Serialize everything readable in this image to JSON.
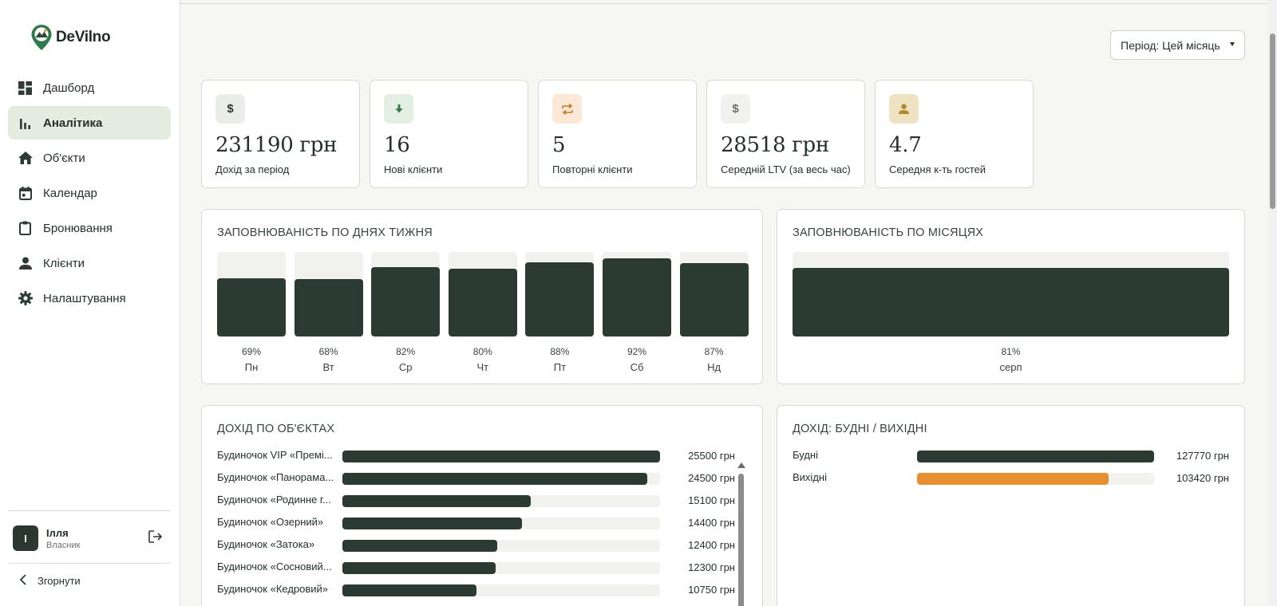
{
  "brand": {
    "name": "DeVilno"
  },
  "sidebar": {
    "items": [
      {
        "label": "Дашборд",
        "icon": "dashboard-icon",
        "active": false
      },
      {
        "label": "Аналітика",
        "icon": "bar-chart-icon",
        "active": true
      },
      {
        "label": "Об'єкти",
        "icon": "home-icon",
        "active": false
      },
      {
        "label": "Календар",
        "icon": "calendar-icon",
        "active": false
      },
      {
        "label": "Бронювання",
        "icon": "clipboard-icon",
        "active": false
      },
      {
        "label": "Клієнти",
        "icon": "person-icon",
        "active": false
      },
      {
        "label": "Налаштування",
        "icon": "gear-icon",
        "active": false
      }
    ],
    "user": {
      "initial": "І",
      "name": "Ілля",
      "role": "Власник"
    },
    "collapse_label": "Згорнути"
  },
  "period": {
    "label": "Період: Цей місяць"
  },
  "kpis": [
    {
      "value": "231190 грн",
      "label": "Дохід за період",
      "icon": "dollar-icon",
      "glyph": "$",
      "bg": "#ebedeb",
      "fg": "#2b3a32"
    },
    {
      "value": "16",
      "label": "Нові клієнти",
      "icon": "arrow-down-icon",
      "glyph": "🡇",
      "bg": "#e3efe3",
      "fg": "#2f7a45"
    },
    {
      "value": "5",
      "label": "Повторні клієнти",
      "icon": "repeat-icon",
      "glyph": "⇄",
      "bg": "#fbe8d6",
      "fg": "#d0781f"
    },
    {
      "value": "28518 грн",
      "label": "Середній LTV (за весь час)",
      "icon": "dollar-icon",
      "glyph": "$",
      "bg": "#f1f1ef",
      "fg": "#6a6f6b"
    },
    {
      "value": "4.7",
      "label": "Середня к-ть гостей",
      "icon": "guest-icon",
      "glyph": "👤",
      "bg": "#efe2c2",
      "fg": "#b08a2e"
    }
  ],
  "occupancy_days": {
    "title": "ЗАПОВНЮВАНІСТЬ ПО ДНЯХ ТИЖНЯ",
    "chart_data": {
      "type": "bar",
      "categories": [
        "Пн",
        "Вт",
        "Ср",
        "Чт",
        "Пт",
        "Сб",
        "Нд"
      ],
      "values": [
        69,
        68,
        82,
        80,
        88,
        92,
        87
      ],
      "labels": [
        "69%",
        "68%",
        "82%",
        "80%",
        "88%",
        "92%",
        "87%"
      ],
      "ylim": [
        0,
        100
      ]
    }
  },
  "occupancy_months": {
    "title": "ЗАПОВНЮВАНІСТЬ ПО МІСЯЦЯХ",
    "chart_data": {
      "type": "bar",
      "categories": [
        "серп"
      ],
      "values": [
        81
      ],
      "labels": [
        "81%"
      ],
      "ylim": [
        0,
        100
      ]
    }
  },
  "revenue_objects": {
    "title": "ДОХІД ПО ОБ'ЄКТАХ",
    "chart_data": {
      "type": "bar",
      "orientation": "horizontal",
      "categories": [
        "Будиночок VIP «Преміум»",
        "Будиночок «Панорамний»",
        "Будиночок «Родинне гніздо»",
        "Будиночок «Озерний»",
        "Будиночок «Затока»",
        "Будиночок «Сосновий бір»",
        "Будиночок «Кедровий»"
      ],
      "display_names": [
        "Будиночок VIP «Премі...",
        "Будиночок «Панорама...",
        "Будиночок «Родинне г...",
        "Будиночок «Озерний»",
        "Будиночок «Затока»",
        "Будиночок «Сосновий...",
        "Будиночок «Кедровий»"
      ],
      "values": [
        25500,
        24500,
        15100,
        14400,
        12400,
        12300,
        10750
      ],
      "labels": [
        "25500 грн",
        "24500 грн",
        "15100 грн",
        "14400 грн",
        "12400 грн",
        "12300 грн",
        "10750 грн"
      ],
      "xlim": [
        0,
        25500
      ]
    }
  },
  "revenue_weekday": {
    "title": "ДОХІД: БУДНІ / ВИХІДНІ",
    "chart_data": {
      "type": "bar",
      "orientation": "horizontal",
      "categories": [
        "Будні",
        "Вихідні"
      ],
      "values": [
        127770,
        103420
      ],
      "labels": [
        "127770 грн",
        "103420 грн"
      ],
      "colors": [
        "#2b3a32",
        "#e8902f"
      ],
      "xlim": [
        0,
        127770
      ]
    }
  }
}
